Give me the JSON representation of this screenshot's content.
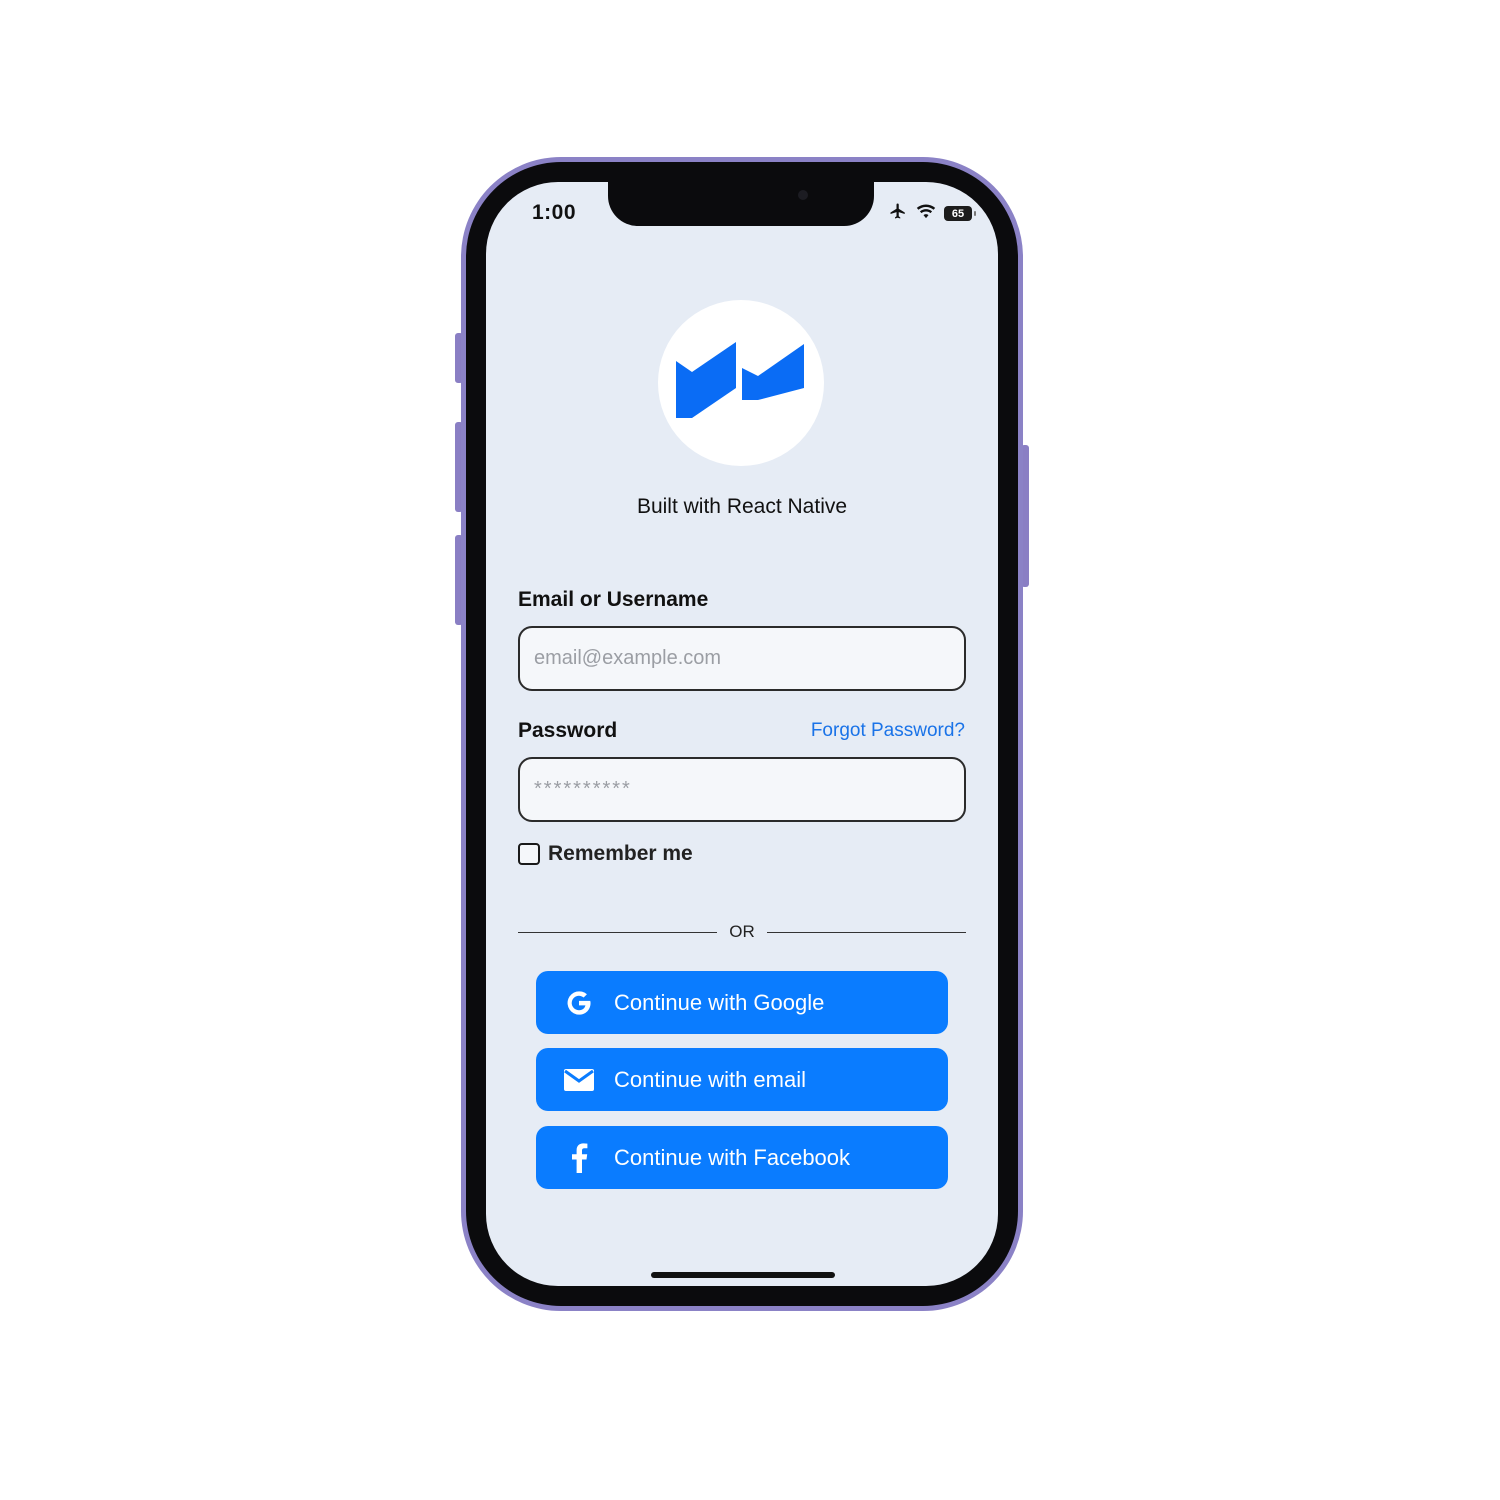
{
  "status_bar": {
    "time": "1:00",
    "battery_level": "65",
    "icons": [
      "airplane-icon",
      "wifi-icon",
      "battery-icon"
    ]
  },
  "brand": {
    "tagline": "Built with React Native",
    "logo_color": "#0a6cf5"
  },
  "form": {
    "email_label": "Email or Username",
    "email_placeholder": "email@example.com",
    "password_label": "Password",
    "password_placeholder": "**********",
    "forgot_password": "Forgot Password?",
    "remember_me": "Remember me",
    "remember_checked": false
  },
  "divider": {
    "text": "OR"
  },
  "social_buttons": [
    {
      "label": "Continue with Google",
      "icon": "google-icon"
    },
    {
      "label": "Continue with email",
      "icon": "mail-icon"
    },
    {
      "label": "Continue with Facebook",
      "icon": "facebook-icon"
    }
  ],
  "colors": {
    "accent": "#0a7cff",
    "link": "#1a73e8",
    "screen_background": "#e6ecf5",
    "frame": "#8b82c6"
  }
}
